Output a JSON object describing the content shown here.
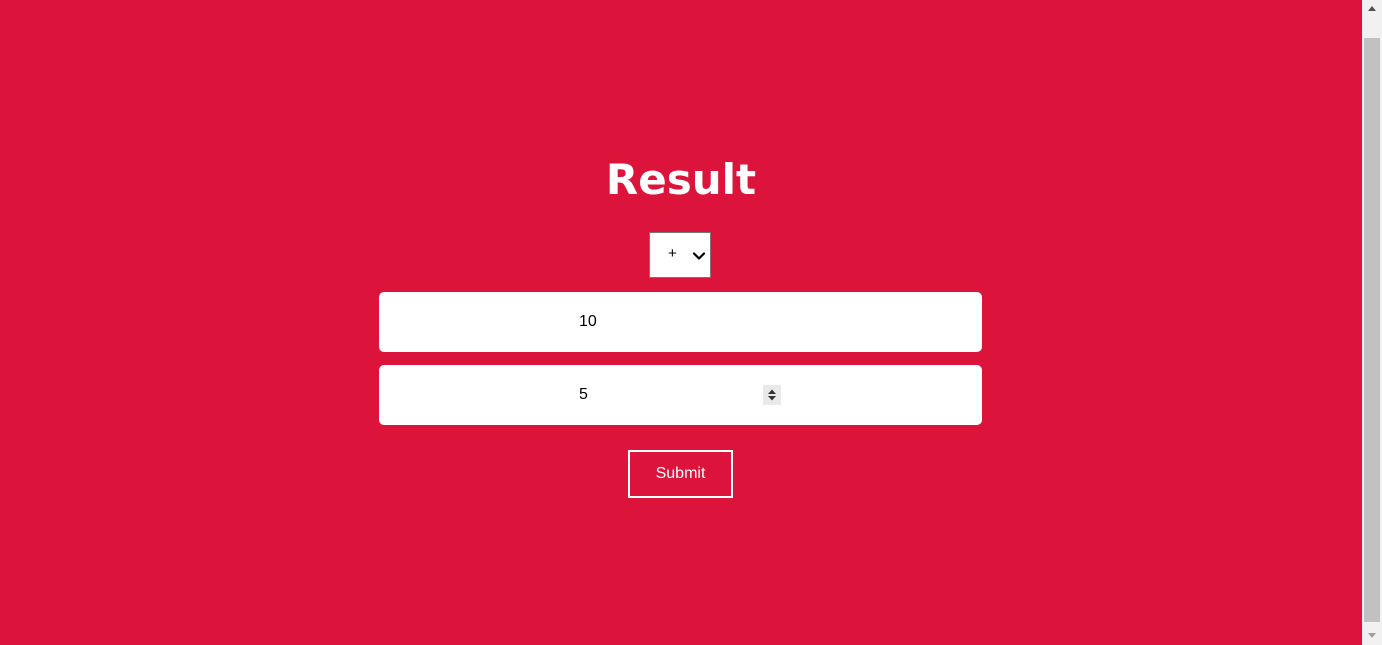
{
  "page": {
    "title": "Result",
    "background_color": "#dc143c"
  },
  "operator_select": {
    "selected": "+",
    "icon": "chevron-down-icon"
  },
  "inputs": {
    "first_value": "10",
    "second_value": "5"
  },
  "submit": {
    "label": "Submit"
  },
  "scrollbar": {
    "up_icon": "scroll-up-arrow-icon",
    "down_icon": "scroll-down-arrow-icon"
  }
}
